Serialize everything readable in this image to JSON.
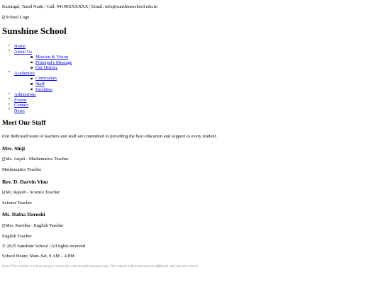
{
  "topbar": {
    "contact_line": "Karungal, Tamil Nadu | Call: 94190XXXXXX | Email: info@sunshineschool.edu.in"
  },
  "header": {
    "logo_alt": "School Logo",
    "title": "Sunshine School"
  },
  "nav": {
    "home": "Home",
    "about": "About Us",
    "about_sub": [
      "Mission & Vision",
      "Principal's Message",
      "Our History"
    ],
    "academics": "Academics",
    "academics_sub": [
      "Curriculum",
      "Staff",
      "Facilities"
    ],
    "admissions": "Admissions",
    "events": "Events",
    "contact": "Contact",
    "news": "News"
  },
  "main": {
    "heading": "Meet Our Staff",
    "intro": "Our dedicated team of teachers and staff are committed to providing the best education and support to every student.",
    "staff": [
      {
        "name": "Mrs. Shiji",
        "image_alt": "Ms. Anjali - Mathematics Teacher",
        "role": "Mathematics Teacher"
      },
      {
        "name": "Rev. D. Darvin Vino",
        "image_alt": "Mr. Rajesh - Science Teacher",
        "role": "Science Teacher"
      },
      {
        "name": "Ms. Dafna Daroshi",
        "image_alt": "Mrs. Kavitha - English Teacher",
        "role": "English Teacher"
      }
    ]
  },
  "footer": {
    "copyright": "© 2025 Sunshine School | All rights reserved",
    "hours": "School Hours: Mon–Sat, 9 AM – 4 PM",
    "note": "Note: This website is a demo project created for educational purposes only. The content is fictional and not affiliated with any real school."
  },
  "colors": {
    "link": "#0000ee",
    "note_text": "#8a8a8a"
  }
}
